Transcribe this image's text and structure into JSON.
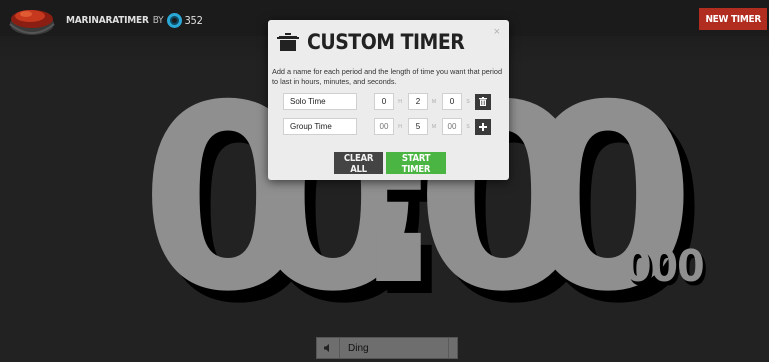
{
  "header": {
    "brand_name": "MARINARATIMER",
    "by_text": "BY",
    "partner_number": "352",
    "new_timer_label": "NEW TIMER",
    "accent_color": "#b12d1f",
    "partner_color": "#29a8d6",
    "icons": [
      "pasta-pot-logo-icon",
      "partner-ring-icon"
    ]
  },
  "clock": {
    "d1": "0",
    "d2": "0",
    "sep": ":",
    "d3": "0",
    "d4": "0",
    "milliseconds": "000"
  },
  "sound": {
    "icon": "speaker-icon",
    "selected": "Ding"
  },
  "modal": {
    "title": "CUSTOM TIMER",
    "title_icon": "pot-icon",
    "close_icon": "close-icon",
    "close_glyph": "×",
    "description": "Add a name for each period and the length of time you want that period to last in hours, minutes, and seconds.",
    "periods": [
      {
        "name": "Solo Time",
        "hours": "0",
        "minutes": "2",
        "seconds": "0",
        "action_icon": "trash-icon"
      },
      {
        "name": "Group Time",
        "hours_placeholder": "00",
        "minutes": "5",
        "seconds_placeholder": "00",
        "action_icon": "plus-icon"
      }
    ],
    "units": {
      "h": "H",
      "m": "M",
      "s": "S"
    },
    "clear_label": "CLEAR ALL",
    "start_label": "START TIMER",
    "start_color": "#4bb543"
  }
}
